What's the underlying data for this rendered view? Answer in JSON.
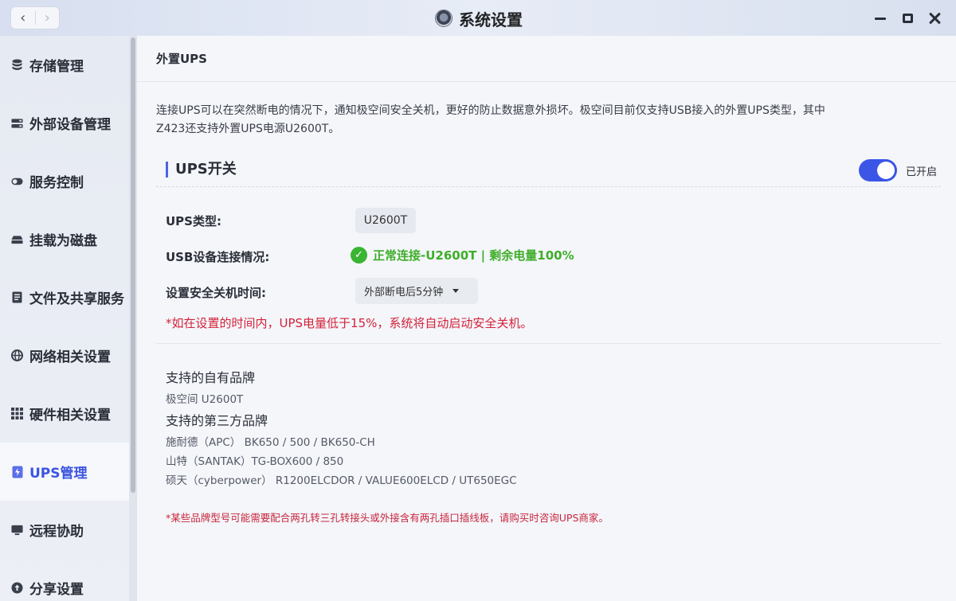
{
  "window": {
    "title": "系统设置",
    "nav_back": "‹",
    "nav_forward": "›"
  },
  "sidebar": {
    "items": [
      {
        "label": "存储管理",
        "icon": "database-icon"
      },
      {
        "label": "外部设备管理",
        "icon": "device-icon"
      },
      {
        "label": "服务控制",
        "icon": "toggle-icon"
      },
      {
        "label": "挂载为磁盘",
        "icon": "drive-icon"
      },
      {
        "label": "文件及共享服务",
        "icon": "document-icon"
      },
      {
        "label": "网络相关设置",
        "icon": "globe-icon"
      },
      {
        "label": "硬件相关设置",
        "icon": "grid-icon"
      },
      {
        "label": "UPS管理",
        "icon": "ups-icon",
        "active": true
      },
      {
        "label": "远程协助",
        "icon": "monitor-icon"
      },
      {
        "label": "分享设置",
        "icon": "share-icon"
      }
    ]
  },
  "main": {
    "header": "外置UPS",
    "description_line1": "连接UPS可以在突然断电的情况下，通知极空间安全关机，更好的防止数据意外损坏。极空间目前仅支持USB接入的外置UPS类型，其中",
    "description_line2": "Z423还支持外置UPS电源U2600T。",
    "section_title": "UPS开关",
    "toggle_label": "已开启",
    "toggle_on": true,
    "ups_type_label": "UPS类型:",
    "ups_type_value": "U2600T",
    "usb_label": "USB设备连接情况:",
    "usb_status": "正常连接-U2600T | 剩余电量100%",
    "shutdown_label": "设置安全关机时间:",
    "shutdown_value": "外部断电后5分钟",
    "warning": "*如在设置的时间内，UPS电量低于15%，系统将自动启动安全关机。",
    "own_brand_title": "支持的自有品牌",
    "own_brand_items": [
      "极空间 U2600T"
    ],
    "third_brand_title": "支持的第三方品牌",
    "third_brand_items": [
      "施耐德（APC） BK650 / 500 / BK650-CH",
      "山特（SANTAK）TG-BOX600 / 850",
      "硕天（cyberpower） R1200ELCDOR / VALUE600ELCD / UT650EGC"
    ],
    "note": "*某些品牌型号可能需要配合两孔转三孔转接头或外接含有两孔插口插线板，请购买时咨询UPS商家。"
  },
  "colors": {
    "accent": "#3b55e6",
    "success": "#39b533",
    "danger": "#d3223a"
  }
}
